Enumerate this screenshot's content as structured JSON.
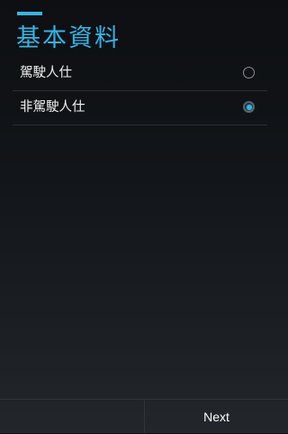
{
  "header": {
    "title": "基本資料"
  },
  "options": [
    {
      "label": "駕駛人仕",
      "checked": false
    },
    {
      "label": "非駕駛人仕",
      "checked": true
    }
  ],
  "footer": {
    "next_label": "Next"
  },
  "colors": {
    "accent": "#33b5e5"
  }
}
